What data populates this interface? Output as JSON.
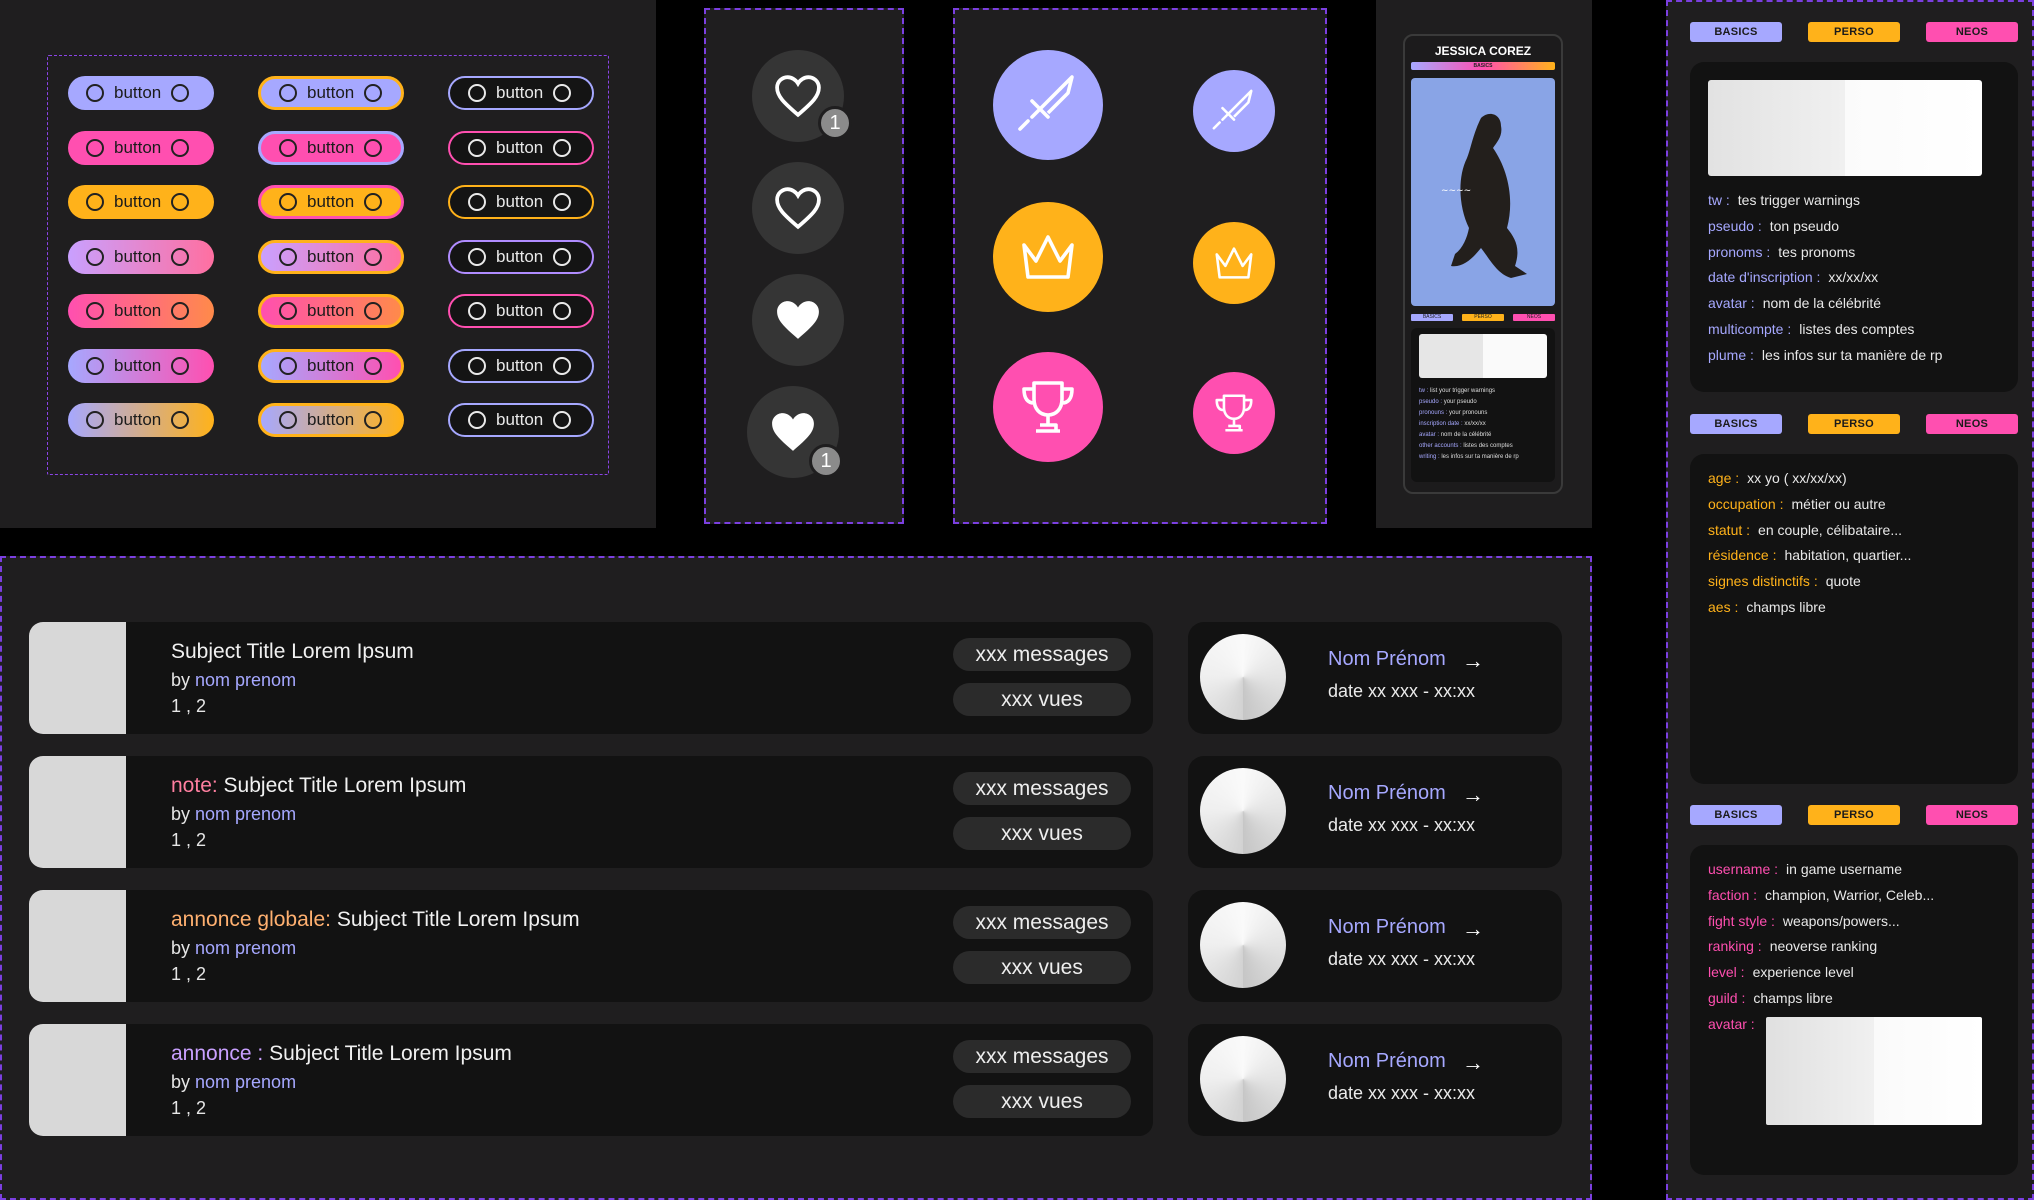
{
  "colors": {
    "purple": "#a6a8ff",
    "pink": "#ff4fb0",
    "orange": "#ffb21a",
    "dash": "#7b3fe0",
    "card": "#121212",
    "panel": "#1f1e1f"
  },
  "buttons": {
    "label": "button"
  },
  "hearts": {
    "badge_top": "1",
    "badge_bottom": "1"
  },
  "icons": [
    "sword-icon",
    "sword-icon",
    "crown-icon",
    "crown-icon",
    "trophy-icon",
    "trophy-icon"
  ],
  "profile": {
    "name": "JESSICA COREZ",
    "strip": "BASICS",
    "tabs": [
      "BASICS",
      "PERSO",
      "NEOS"
    ],
    "rows": [
      {
        "k": "tw :",
        "v": "list your trigger warnings"
      },
      {
        "k": "pseudo :",
        "v": "your pseudo"
      },
      {
        "k": "pronouns :",
        "v": "your pronouns"
      },
      {
        "k": "inscription date :",
        "v": "xx/xx/xx"
      },
      {
        "k": "avatar :",
        "v": "nom de la célébrité"
      },
      {
        "k": "other accounts :",
        "v": "listes des comptes"
      },
      {
        "k": "writing :",
        "v": "les infos sur ta manière de rp"
      }
    ]
  },
  "right": {
    "tabs": [
      "BASICS",
      "PERSO",
      "NEOS"
    ],
    "basics": [
      {
        "k": "tw :",
        "v": "tes trigger warnings"
      },
      {
        "k": "pseudo :",
        "v": "ton pseudo"
      },
      {
        "k": "pronoms :",
        "v": "tes pronoms"
      },
      {
        "k": "date d'inscription :",
        "v": "xx/xx/xx"
      },
      {
        "k": "avatar :",
        "v": "nom de la célébrité"
      },
      {
        "k": "multicompte :",
        "v": "listes des comptes"
      },
      {
        "k": "plume :",
        "v": "les infos sur ta manière de rp"
      }
    ],
    "perso": [
      {
        "k": "age :",
        "v": "xx yo ( xx/xx/xx)"
      },
      {
        "k": "occupation :",
        "v": "métier ou autre"
      },
      {
        "k": "statut :",
        "v": "en couple, célibataire..."
      },
      {
        "k": "résidence :",
        "v": "habitation, quartier..."
      },
      {
        "k": "signes distinctifs :",
        "v": "quote"
      },
      {
        "k": "aes :",
        "v": "champs libre"
      }
    ],
    "neos": [
      {
        "k": "username :",
        "v": "in game username"
      },
      {
        "k": "faction :",
        "v": "champion, Warrior, Celeb..."
      },
      {
        "k": "fight style :",
        "v": "weapons/powers..."
      },
      {
        "k": "ranking :",
        "v": "neoverse ranking"
      },
      {
        "k": "level :",
        "v": "experience level"
      },
      {
        "k": "guild :",
        "v": "champs libre"
      },
      {
        "k": "avatar :",
        "v": ""
      }
    ]
  },
  "forum": {
    "topics": [
      {
        "prefix": "",
        "title": "Subject Title Lorem Ipsum",
        "by": "by ",
        "author": "nom prenom",
        "pages": "1 , 2",
        "messages": "xxx messages",
        "views": "xxx vues"
      },
      {
        "prefix": "note: ",
        "title": "Subject Title Lorem Ipsum",
        "by": "by ",
        "author": "nom prenom",
        "pages": "1 , 2",
        "messages": "xxx messages",
        "views": "xxx vues"
      },
      {
        "prefix": "annonce globale: ",
        "title": "Subject Title Lorem Ipsum",
        "by": "by ",
        "author": "nom prenom",
        "pages": "1 , 2",
        "messages": "xxx messages",
        "views": "xxx vues"
      },
      {
        "prefix": "annonce : ",
        "title": "Subject Title Lorem Ipsum",
        "by": "by ",
        "author": "nom prenom",
        "pages": "1 , 2",
        "messages": "xxx messages",
        "views": "xxx vues"
      }
    ],
    "lastposts": [
      {
        "name": "Nom Prénom",
        "arrow": "→",
        "date": "date xx xxx - xx:xx"
      },
      {
        "name": "Nom Prénom",
        "arrow": "→",
        "date": "date xx xxx - xx:xx"
      },
      {
        "name": "Nom Prénom",
        "arrow": "→",
        "date": "date xx xxx - xx:xx"
      },
      {
        "name": "Nom Prénom",
        "arrow": "→",
        "date": "date xx xxx - xx:xx"
      }
    ]
  }
}
